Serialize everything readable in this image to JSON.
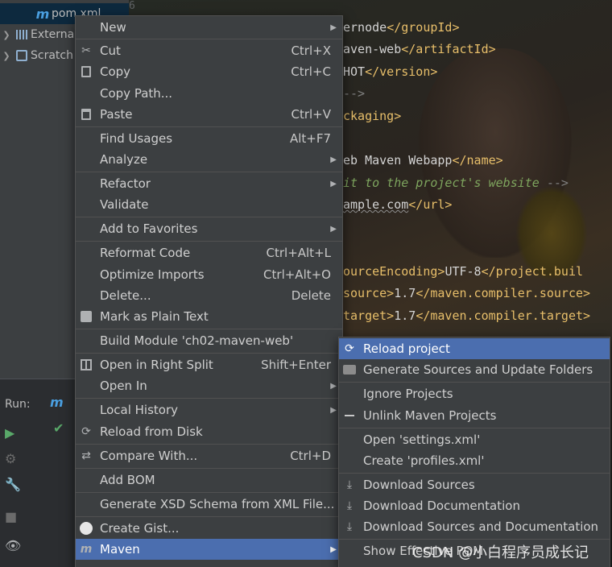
{
  "project_tree": {
    "items": [
      {
        "label": "pom.xml",
        "icon": "maven-file-icon",
        "selected": true
      },
      {
        "label": "Externa",
        "icon": "libraries-icon"
      },
      {
        "label": "Scratch",
        "icon": "scratches-icon"
      }
    ]
  },
  "editor": {
    "line_number": "6",
    "lines": [
      {
        "parts": [
          {
            "t": "ernode",
            "c": "txt"
          },
          {
            "t": "</groupId>",
            "c": "tag"
          }
        ]
      },
      {
        "parts": [
          {
            "t": "aven-web",
            "c": "txt"
          },
          {
            "t": "</artifactId>",
            "c": "tag"
          }
        ]
      },
      {
        "parts": [
          {
            "t": "HOT",
            "c": "txt"
          },
          {
            "t": "</version>",
            "c": "tag"
          }
        ]
      },
      {
        "parts": [
          {
            "t": "-->",
            "c": "cmt-plain"
          }
        ]
      },
      {
        "parts": [
          {
            "t": "ckaging>",
            "c": "tag"
          }
        ]
      },
      {
        "parts": []
      },
      {
        "parts": [
          {
            "t": "eb Maven Webapp",
            "c": "txt"
          },
          {
            "t": "</name>",
            "c": "tag"
          }
        ]
      },
      {
        "parts": [
          {
            "t": "it to the project's website ",
            "c": "cmt"
          },
          {
            "t": "-->",
            "c": "cmt-plain"
          }
        ]
      },
      {
        "parts": [
          {
            "t": "ample.com",
            "c": "txt ul"
          },
          {
            "t": "</url>",
            "c": "tag"
          }
        ]
      },
      {
        "parts": []
      },
      {
        "parts": []
      },
      {
        "parts": [
          {
            "t": "ourceEncoding>",
            "c": "tag"
          },
          {
            "t": "UTF-8",
            "c": "txt"
          },
          {
            "t": "</project.buil",
            "c": "tag"
          }
        ]
      },
      {
        "parts": [
          {
            "t": "source>",
            "c": "tag"
          },
          {
            "t": "1.7",
            "c": "txt"
          },
          {
            "t": "</maven.compiler.source>",
            "c": "tag"
          }
        ]
      },
      {
        "parts": [
          {
            "t": "target>",
            "c": "tag"
          },
          {
            "t": "1.7",
            "c": "txt"
          },
          {
            "t": "</maven.compiler.target>",
            "c": "tag"
          }
        ]
      }
    ]
  },
  "run_panel": {
    "label": "Run:"
  },
  "context_menu": {
    "new": "New",
    "cut": "Cut",
    "cut_sc": "Ctrl+X",
    "copy": "Copy",
    "copy_sc": "Ctrl+C",
    "copy_path": "Copy Path...",
    "paste": "Paste",
    "paste_sc": "Ctrl+V",
    "find_usages": "Find Usages",
    "find_usages_sc": "Alt+F7",
    "analyze": "Analyze",
    "refactor": "Refactor",
    "validate": "Validate",
    "add_favorites": "Add to Favorites",
    "reformat": "Reformat Code",
    "reformat_sc": "Ctrl+Alt+L",
    "optimize": "Optimize Imports",
    "optimize_sc": "Ctrl+Alt+O",
    "delete": "Delete...",
    "delete_sc": "Delete",
    "mark_plain": "Mark as Plain Text",
    "build_module": "Build Module 'ch02-maven-web'",
    "open_split": "Open in Right Split",
    "open_split_sc": "Shift+Enter",
    "open_in": "Open In",
    "local_history": "Local History",
    "reload_disk": "Reload from Disk",
    "compare": "Compare With...",
    "compare_sc": "Ctrl+D",
    "add_bom": "Add BOM",
    "gen_xsd": "Generate XSD Schema from XML File...",
    "create_gist": "Create Gist...",
    "maven": "Maven"
  },
  "maven_submenu": {
    "reload": "Reload project",
    "generate": "Generate Sources and Update Folders",
    "ignore": "Ignore Projects",
    "unlink": "Unlink Maven Projects",
    "open_settings": "Open 'settings.xml'",
    "create_profiles": "Create 'profiles.xml'",
    "dl_sources": "Download Sources",
    "dl_docs": "Download Documentation",
    "dl_both": "Download Sources and Documentation",
    "show_effective": "Show Effective POM"
  },
  "watermark": "CSDN @小白程序员成长记",
  "colors": {
    "highlight": "#4b6eaf",
    "menu_bg": "#3c3f41",
    "xml_tag": "#e8bf6a",
    "comment": "#7ea55e"
  }
}
